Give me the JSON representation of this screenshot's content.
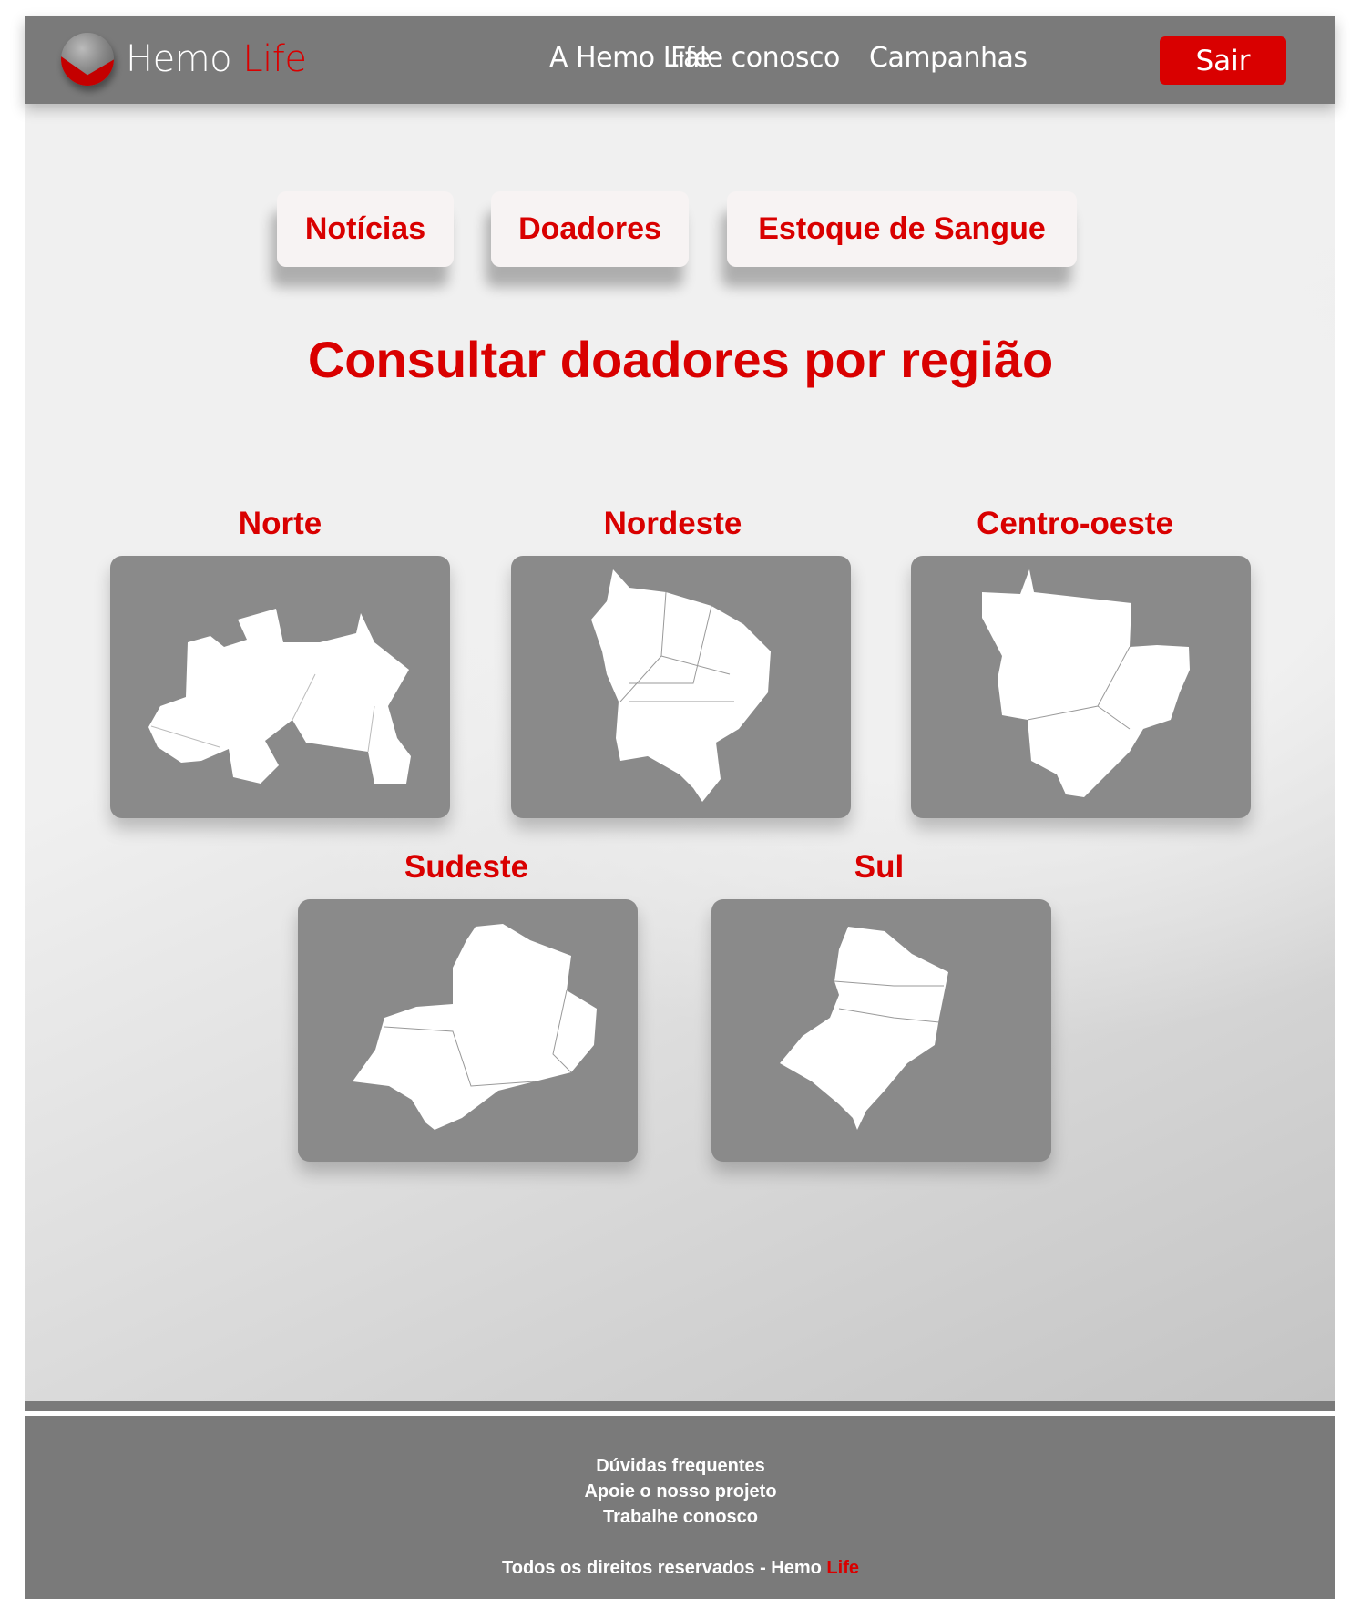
{
  "header": {
    "brand_main": "Hemo",
    "brand_accent": "Life",
    "nav": [
      "A Hemo Life",
      "Fale conosco",
      "Campanhas"
    ],
    "logout_label": "Sair",
    "accent_color": "#d90000"
  },
  "tabs": [
    "Notícias",
    "Doadores",
    "Estoque de Sangue"
  ],
  "page_title": "Consultar doadores por região",
  "regions": [
    {
      "label": "Norte",
      "icon": "norte-map"
    },
    {
      "label": "Nordeste",
      "icon": "nordeste-map"
    },
    {
      "label": "Centro-oeste",
      "icon": "centro-oeste-map"
    },
    {
      "label": "Sudeste",
      "icon": "sudeste-map"
    },
    {
      "label": "Sul",
      "icon": "sul-map"
    }
  ],
  "footer": {
    "links": [
      "Dúvidas frequentes",
      "Apoie o nosso projeto",
      "Trabalhe conosco"
    ],
    "copyright": "Todos os direitos reservados - Hemo",
    "copyright_accent": "Life"
  }
}
